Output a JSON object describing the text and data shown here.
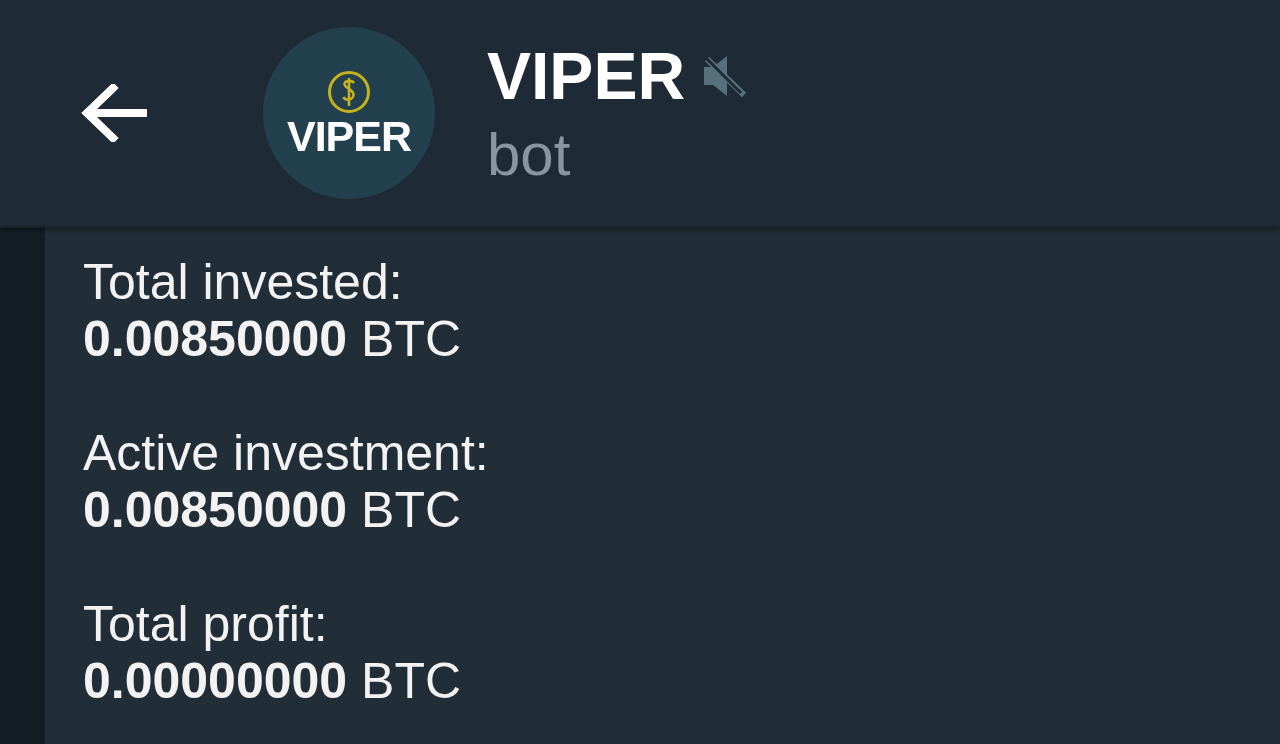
{
  "header": {
    "title": "VIPER",
    "subtitle": "bot",
    "muted": true,
    "avatar": {
      "logo_text": "VIPER"
    }
  },
  "message": {
    "groups": [
      {
        "label": "Total invested:",
        "value": "**0.00850000** BTC"
      },
      {
        "label": "Active investment:",
        "value": "**0.00850000** BTC"
      },
      {
        "label": "Total profit:",
        "value": "**0.00000000** BTC"
      }
    ]
  }
}
